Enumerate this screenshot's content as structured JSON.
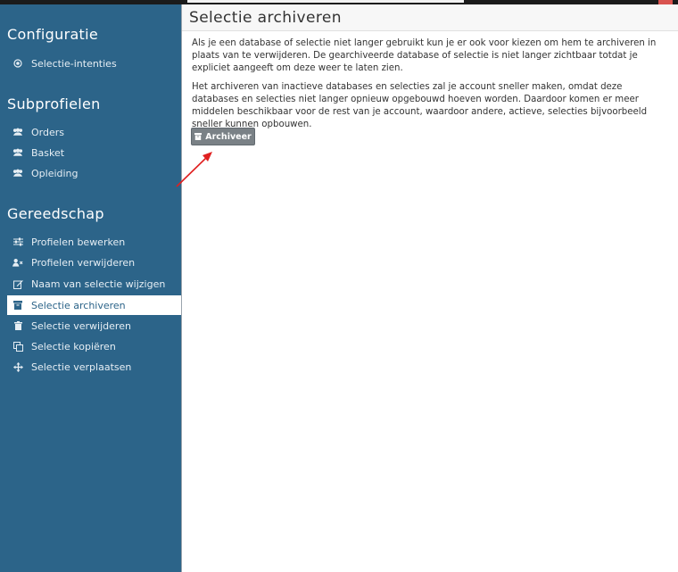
{
  "page": {
    "title": "Selectie archiveren"
  },
  "sidebar": {
    "sections": [
      {
        "title": "Configuratie"
      },
      {
        "title": "Subprofielen"
      },
      {
        "title": "Gereedschap"
      }
    ],
    "configuratie_items": [
      {
        "label": "Selectie-intenties",
        "icon": "target-icon"
      }
    ],
    "subprofielen_items": [
      {
        "label": "Orders",
        "icon": "users-icon"
      },
      {
        "label": "Basket",
        "icon": "users-icon"
      },
      {
        "label": "Opleiding",
        "icon": "users-icon"
      }
    ],
    "gereedschap_items": [
      {
        "label": "Profielen bewerken",
        "icon": "sliders-icon"
      },
      {
        "label": "Profielen verwijderen",
        "icon": "user-remove-icon"
      },
      {
        "label": "Naam van selectie wijzigen",
        "icon": "edit-icon"
      },
      {
        "label": "Selectie archiveren",
        "icon": "archive-icon",
        "active": true
      },
      {
        "label": "Selectie verwijderen",
        "icon": "trash-icon"
      },
      {
        "label": "Selectie kopiëren",
        "icon": "copy-icon"
      },
      {
        "label": "Selectie verplaatsen",
        "icon": "move-icon"
      }
    ]
  },
  "main": {
    "paragraphs": [
      "Als je een database of selectie niet langer gebruikt kun je er ook voor kiezen om hem te archiveren in plaats van te verwijderen. De gearchiveerde database of selectie is niet langer zichtbaar totdat je expliciet aangeeft om deze weer te laten zien.",
      "Het archiveren van inactieve databases en selecties zal je account sneller maken, omdat deze databases en selecties niet langer opnieuw opgebouwd hoeven worden. Daardoor komen er meer middelen beschikbaar voor de rest van je account, waardoor andere, actieve, selecties bijvoorbeeld sneller kunnen opbouwen."
    ],
    "archive_button_label": "Archiveer"
  },
  "colors": {
    "sidebar_bg": "#2c6489",
    "button_bg": "#7a8186",
    "annotation_arrow": "#e02020"
  }
}
